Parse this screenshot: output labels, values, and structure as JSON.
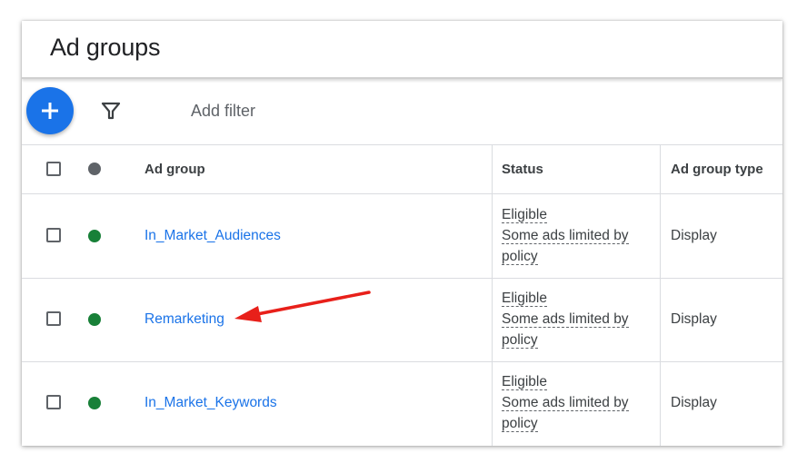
{
  "header": {
    "title": "Ad groups"
  },
  "toolbar": {
    "add_icon": "plus-icon",
    "filter_icon": "filter-funnel-icon",
    "add_filter_label": "Add filter"
  },
  "table": {
    "columns": [
      "Ad group",
      "Status",
      "Ad group type"
    ],
    "rows": [
      {
        "name": "In_Market_Audiences",
        "status": "Eligible",
        "status_detail_line1": "Some ads limited by",
        "status_detail_line2": "policy",
        "type": "Display"
      },
      {
        "name": "Remarketing",
        "status": "Eligible",
        "status_detail_line1": "Some ads limited by",
        "status_detail_line2": "policy",
        "type": "Display"
      },
      {
        "name": "In_Market_Keywords",
        "status": "Eligible",
        "status_detail_line1": "Some ads limited by",
        "status_detail_line2": "policy",
        "type": "Display"
      }
    ]
  },
  "colors": {
    "accent": "#1a73e8",
    "status_enabled": "#188038",
    "header_dot": "#5f6368",
    "annotation_arrow": "#e8201a"
  }
}
